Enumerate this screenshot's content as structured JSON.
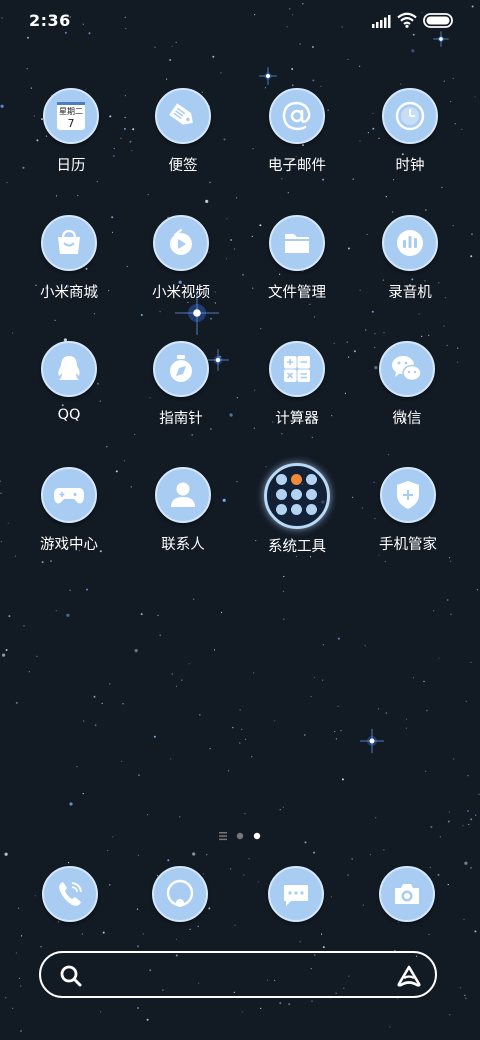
{
  "status_bar": {
    "time": "2:36"
  },
  "calendar_icon": {
    "weekday": "星期二",
    "day": "7"
  },
  "apps": [
    {
      "label": "日历",
      "icon": "calendar-icon"
    },
    {
      "label": "便签",
      "icon": "notes-icon"
    },
    {
      "label": "电子邮件",
      "icon": "email-icon"
    },
    {
      "label": "时钟",
      "icon": "clock-icon"
    },
    {
      "label": "小米商城",
      "icon": "shopping-bag-icon"
    },
    {
      "label": "小米视频",
      "icon": "video-play-icon"
    },
    {
      "label": "文件管理",
      "icon": "folder-icon"
    },
    {
      "label": "录音机",
      "icon": "recorder-icon"
    },
    {
      "label": "QQ",
      "icon": "qq-penguin-icon"
    },
    {
      "label": "指南针",
      "icon": "compass-icon"
    },
    {
      "label": "计算器",
      "icon": "calculator-icon"
    },
    {
      "label": "微信",
      "icon": "wechat-icon"
    },
    {
      "label": "游戏中心",
      "icon": "gamepad-icon"
    },
    {
      "label": "联系人",
      "icon": "contacts-icon"
    },
    {
      "label": "系统工具",
      "icon": "folder-group-icon"
    },
    {
      "label": "手机管家",
      "icon": "shield-icon"
    }
  ],
  "dock": [
    {
      "icon": "phone-icon"
    },
    {
      "icon": "browser-icon"
    },
    {
      "icon": "messages-icon"
    },
    {
      "icon": "camera-icon"
    }
  ],
  "pager": {
    "pages": 3,
    "current": 3
  },
  "colors": {
    "icon_fill": "#a9cdf2",
    "icon_ring": "#d5e8fb",
    "folder_accent": "#f08a3a",
    "background": "#121a24"
  }
}
